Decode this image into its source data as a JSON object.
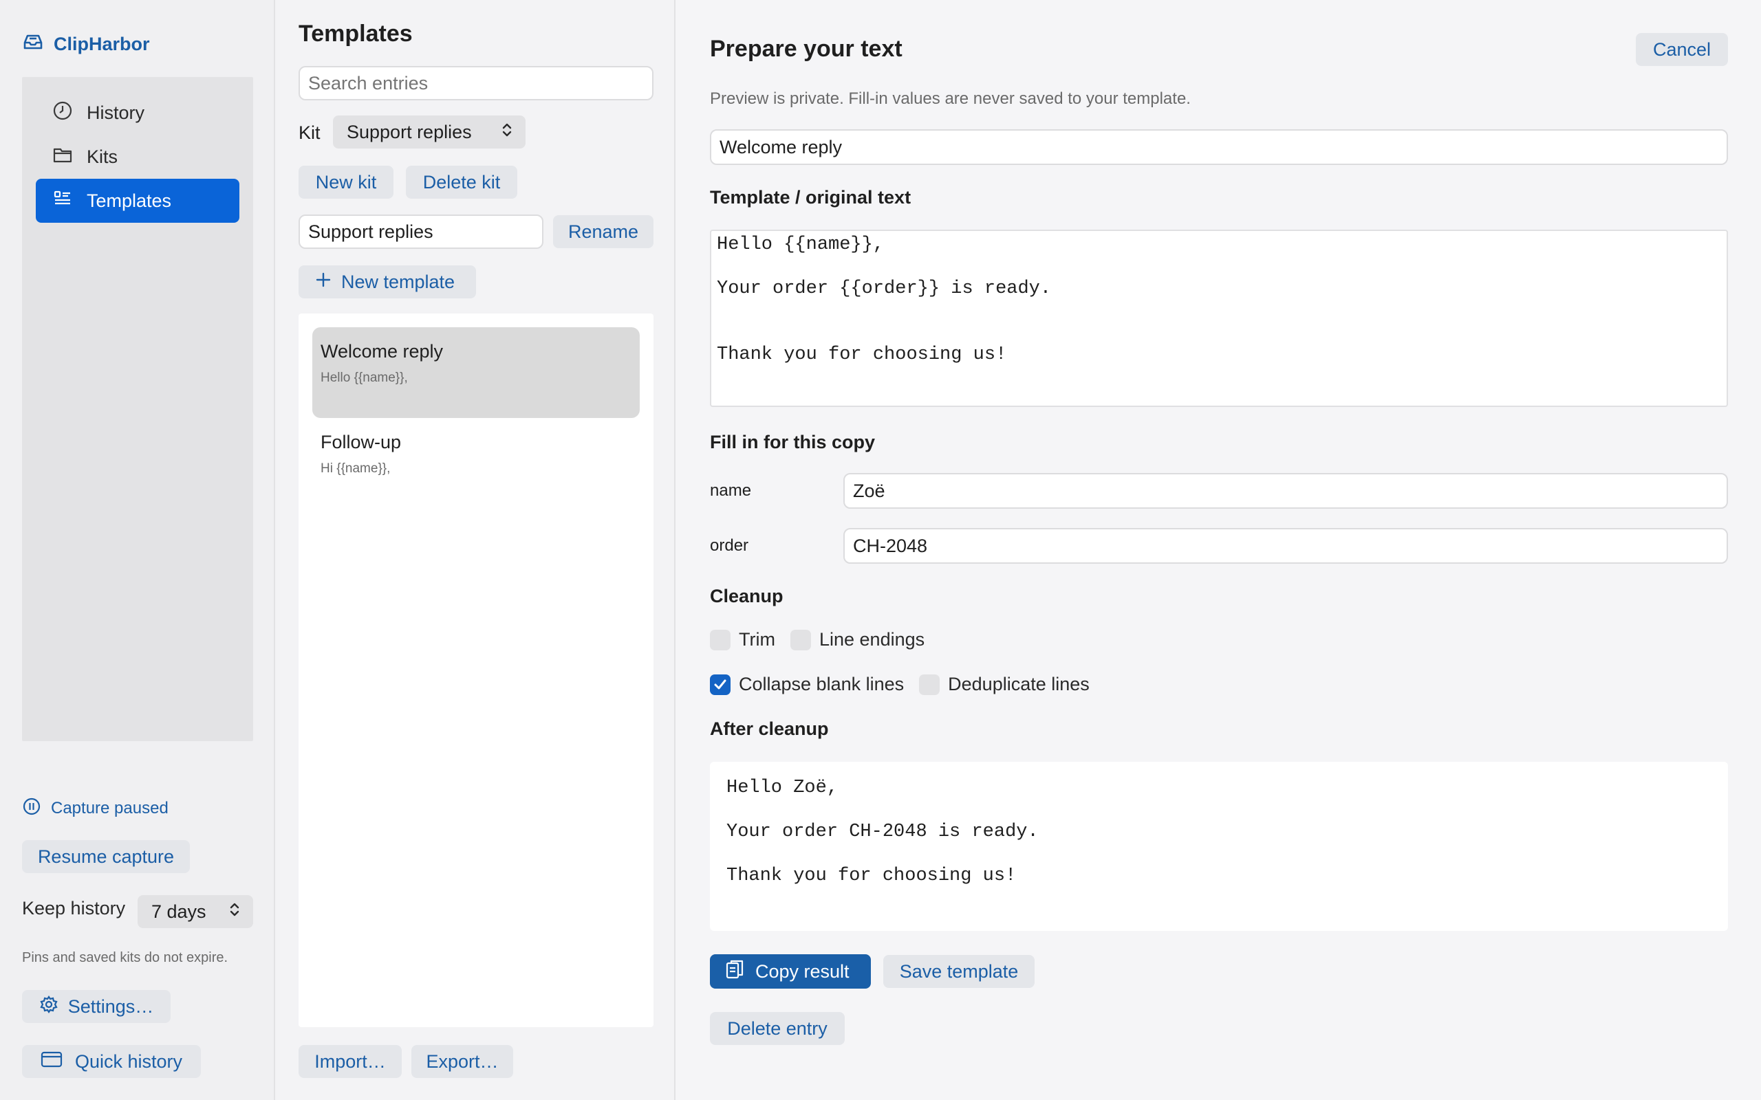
{
  "app": {
    "name": "ClipHarbor"
  },
  "sidebar": {
    "items": [
      {
        "label": "History",
        "icon": "clock-icon"
      },
      {
        "label": "Kits",
        "icon": "folder-icon"
      },
      {
        "label": "Templates",
        "icon": "list-icon",
        "active": true
      }
    ],
    "capture_status": "Capture paused",
    "resume_label": "Resume capture",
    "keep_history_label": "Keep history",
    "keep_history_value": "7 days",
    "note": "Pins and saved kits do not expire.",
    "settings_label": "Settings…",
    "quick_history_label": "Quick history"
  },
  "templates": {
    "title": "Templates",
    "search_placeholder": "Search entries",
    "kit_label": "Kit",
    "kit_value": "Support replies",
    "new_kit_label": "New kit",
    "delete_kit_label": "Delete kit",
    "rename_value": "Support replies",
    "rename_label": "Rename",
    "new_template_label": "New template",
    "items": [
      {
        "title": "Welcome reply",
        "preview": "Hello {{name}},",
        "selected": true
      },
      {
        "title": "Follow-up",
        "preview": "Hi {{name}},",
        "selected": false
      }
    ],
    "import_label": "Import…",
    "export_label": "Export…"
  },
  "prepare": {
    "title": "Prepare your text",
    "cancel_label": "Cancel",
    "subtitle": "Preview is private. Fill-in values are never saved to your template.",
    "template_name": "Welcome reply",
    "original_label": "Template / original text",
    "original_text": "Hello {{name}},\n\nYour order {{order}} is ready.\n\n\nThank you for choosing us!",
    "fill_label": "Fill in for this copy",
    "fields": [
      {
        "name": "name",
        "value": "Zoë"
      },
      {
        "name": "order",
        "value": "CH-2048"
      }
    ],
    "cleanup_label": "Cleanup",
    "cleanup_options": [
      {
        "label": "Trim",
        "checked": false
      },
      {
        "label": "Line endings",
        "checked": false
      },
      {
        "label": "Collapse blank lines",
        "checked": true
      },
      {
        "label": "Deduplicate lines",
        "checked": false
      }
    ],
    "after_label": "After cleanup",
    "result_text": "Hello Zoë,\n\nYour order CH-2048 is ready.\n\nThank you for choosing us!",
    "copy_label": "Copy result",
    "save_label": "Save template",
    "delete_label": "Delete entry"
  },
  "colors": {
    "accent": "#1b5ea6",
    "active_nav": "#0a64d8",
    "primary_button": "#1a5fa8"
  }
}
